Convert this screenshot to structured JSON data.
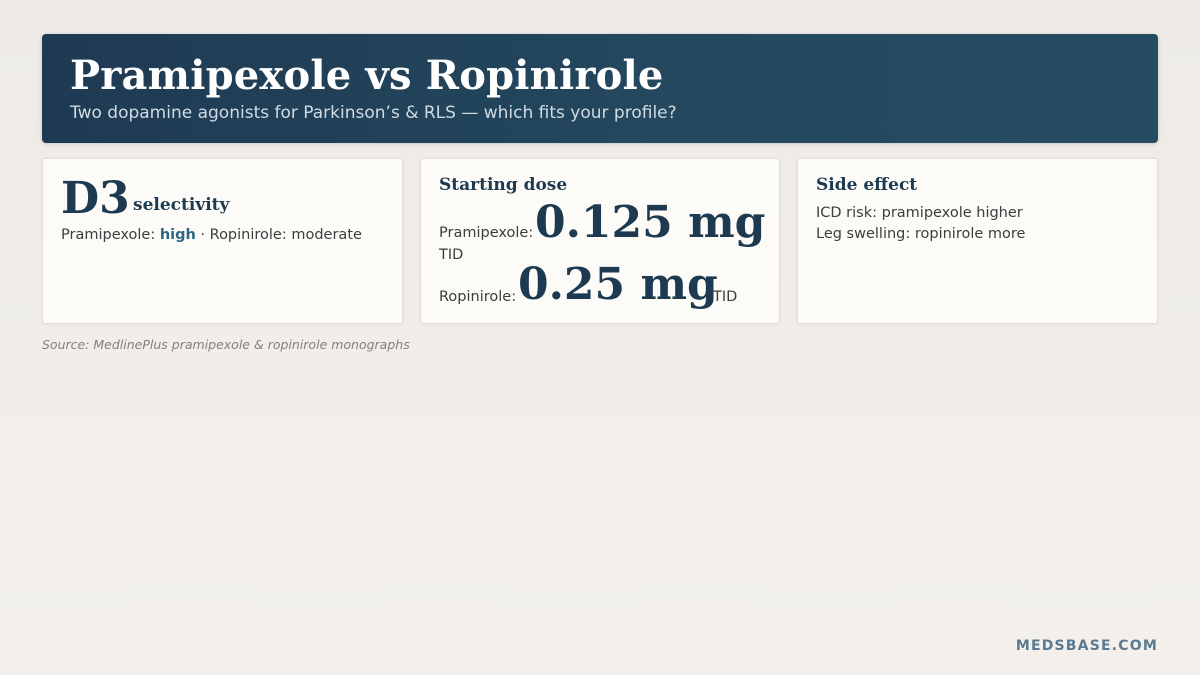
{
  "header": {
    "title": "Pramipexole vs Ropinirole",
    "subtitle": "Two dopamine agonists for Parkinson’s & RLS — which fits your profile?"
  },
  "selectivity_card": {
    "stat": "D3",
    "stat_unit": "selectivity",
    "pramipexole_label": "Pramipexole: ",
    "pramipexole_value": "high",
    "separator": " · ",
    "ropinirole_text": "Ropinirole: moderate"
  },
  "dose_card": {
    "heading": "Starting dose",
    "pramipexole_label": "Pramipexole:",
    "pramipexole_dose": "0.125 mg",
    "pramipexole_freq": "TID",
    "ropinirole_label": "Ropinirole:",
    "ropinirole_dose": "0.25 mg",
    "ropinirole_freq": "TID"
  },
  "side_effect_card": {
    "heading": "Side effect",
    "lines": [
      "ICD risk: pramipexole higher",
      "Leg swelling: ropinirole more"
    ]
  },
  "source": "Source: MedlinePlus pramipexole & ropinirole monographs",
  "brand": "MEDSBASE.COM",
  "colors": {
    "header_bg": "#1f3a53",
    "accent": "#2e6784",
    "heading_text": "#1e3a50",
    "brand": "#5b7a91"
  }
}
